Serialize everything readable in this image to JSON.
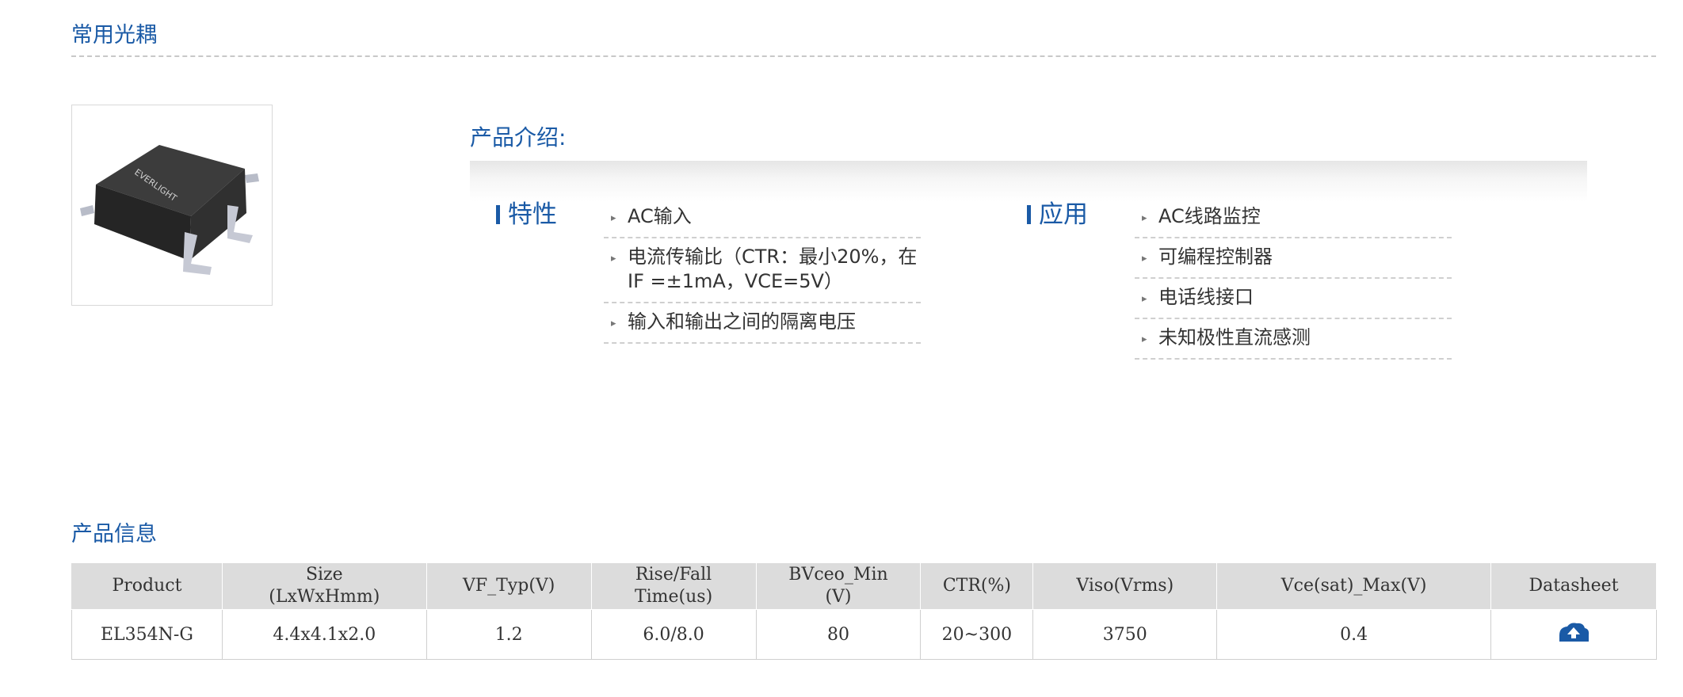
{
  "sections": {
    "common_title": "常用光耦",
    "info_title": "产品信息"
  },
  "product_image": {
    "brand_text": "EVERLIGHT"
  },
  "intro": {
    "title": "产品介绍:",
    "features": {
      "heading": "特性",
      "items": [
        "AC输入",
        "电流传输比（CTR：最小20%，在IF =±1mA，VCE=5V）",
        "输入和输出之间的隔离电压"
      ]
    },
    "applications": {
      "heading": "应用",
      "items": [
        "AC线路监控",
        "可编程控制器",
        "电话线接口",
        "未知极性直流感测"
      ]
    }
  },
  "table": {
    "headers": [
      "Product",
      "Size (LxWxHmm)",
      "VF_Typ(V)",
      "Rise/Fall Time(us)",
      "BVceo_Min (V)",
      "CTR(%)",
      "Viso(Vrms)",
      "Vce(sat)_Max(V)",
      "Datasheet"
    ],
    "rows": [
      [
        "EL354N-G",
        "4.4x4.1x2.0",
        "1.2",
        "6.0/8.0",
        "80",
        "20~300",
        "3750",
        "0.4",
        ""
      ]
    ]
  },
  "icons": {
    "datasheet": "download-icon",
    "bullet": "triangle-right-icon"
  },
  "colors": {
    "accent": "#1a5aa6",
    "table_header": "#dcdcdc"
  }
}
